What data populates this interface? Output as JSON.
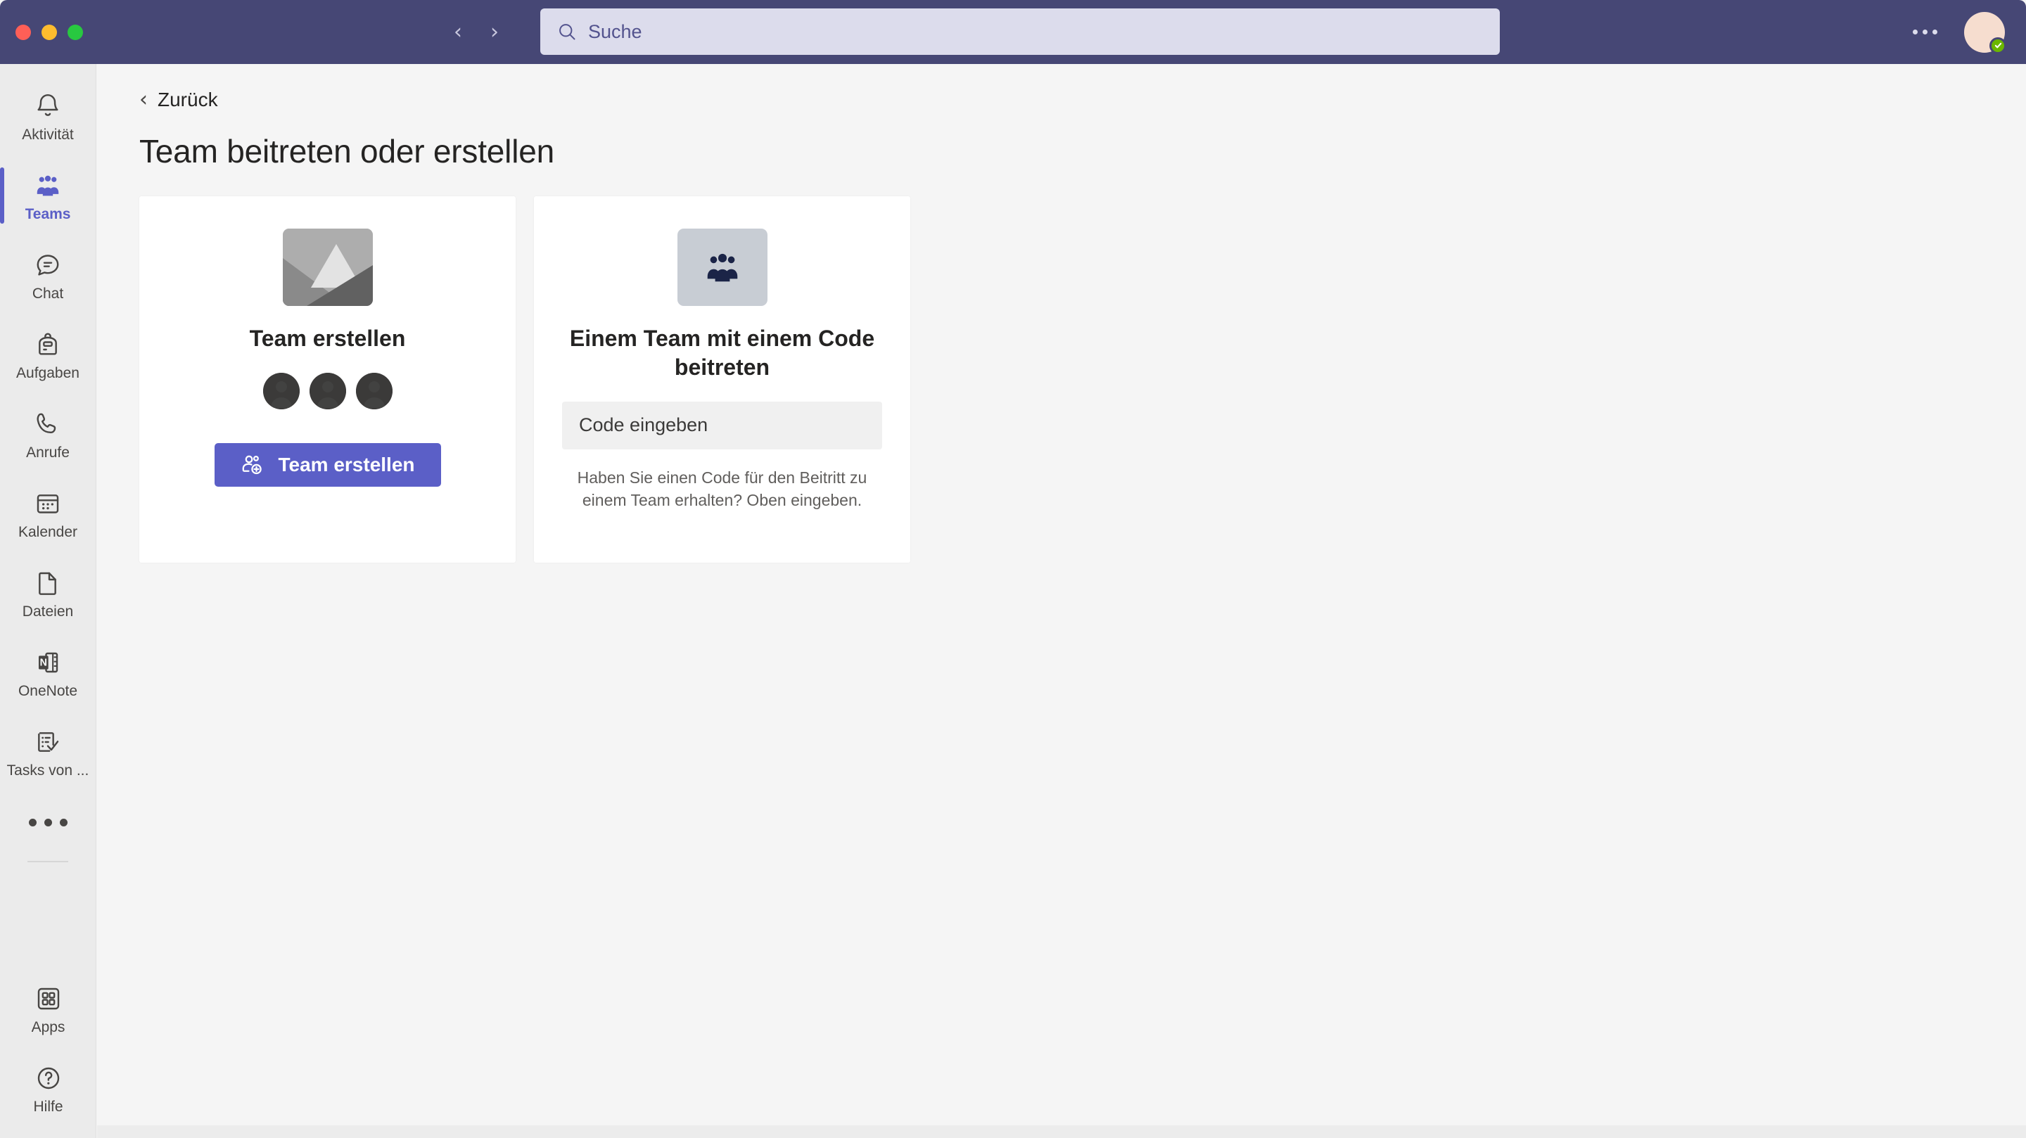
{
  "window": {
    "traffic_lights": [
      "close",
      "minimize",
      "maximize"
    ],
    "accent_color": "#464775",
    "brand_purple": "#5b5fc7"
  },
  "header": {
    "back_arrow_icon": "chevron-left-icon",
    "forward_arrow_icon": "chevron-right-icon",
    "search": {
      "placeholder": "Suche",
      "value": "",
      "icon": "search-icon"
    },
    "more_options_icon": "ellipsis-icon",
    "avatar": {
      "icon": "avatar",
      "presence_status": "available",
      "presence_color": "#6bb700"
    }
  },
  "sidebar": {
    "items": [
      {
        "label": "Aktivität",
        "icon": "bell-icon",
        "active": false
      },
      {
        "label": "Teams",
        "icon": "people-icon",
        "active": true
      },
      {
        "label": "Chat",
        "icon": "chat-icon",
        "active": false
      },
      {
        "label": "Aufgaben",
        "icon": "backpack-icon",
        "active": false
      },
      {
        "label": "Anrufe",
        "icon": "phone-icon",
        "active": false
      },
      {
        "label": "Kalender",
        "icon": "calendar-icon",
        "active": false
      },
      {
        "label": "Dateien",
        "icon": "file-icon",
        "active": false
      },
      {
        "label": "OneNote",
        "icon": "onenote-icon",
        "active": false
      },
      {
        "label": "Tasks von ...",
        "icon": "tasks-icon",
        "active": false
      }
    ],
    "more_apps_icon": "ellipsis-icon",
    "bottom_items": [
      {
        "label": "Apps",
        "icon": "grid-apps-icon"
      },
      {
        "label": "Hilfe",
        "icon": "question-circle-icon"
      }
    ]
  },
  "main": {
    "back": {
      "label": "Zurück",
      "icon": "chevron-left-icon"
    },
    "page_title": "Team beitreten oder erstellen",
    "cards": [
      {
        "id": "create-team",
        "image_icon": "image-placeholder-mountain-icon",
        "title": "Team erstellen",
        "avatar_count": 3,
        "button": {
          "label": "Team erstellen",
          "icon": "add-person-icon"
        }
      },
      {
        "id": "join-team-with-code",
        "image_icon": "people-group-icon",
        "title": "Einem Team mit einem Code beitreten",
        "input": {
          "placeholder": "Code eingeben",
          "value": ""
        },
        "hint": "Haben Sie einen Code für den Beitritt zu einem Team erhalten? Oben eingeben."
      }
    ]
  }
}
